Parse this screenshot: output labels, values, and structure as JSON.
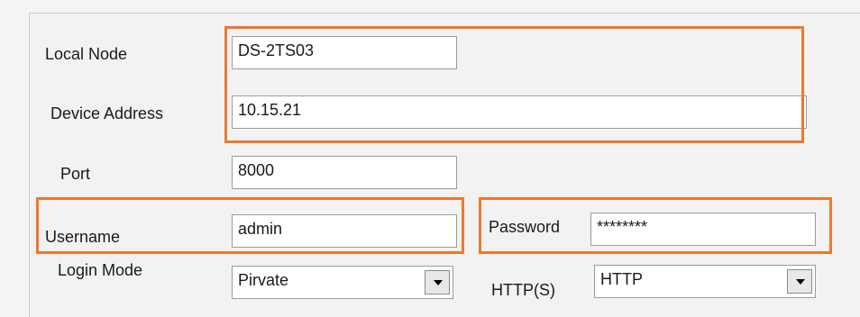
{
  "colors": {
    "highlight": "#ec7a2c",
    "field_border": "#9c9c9c",
    "background": "#f4f4f4"
  },
  "form": {
    "local_node": {
      "label": "Local Node",
      "value": "DS-2TS03"
    },
    "device_address": {
      "label": "Device Address",
      "value": "10.15.21"
    },
    "port": {
      "label": "Port",
      "value": "8000"
    },
    "username": {
      "label": "Username",
      "value": "admin"
    },
    "password": {
      "label": "Password",
      "value": "********"
    },
    "login_mode": {
      "label": "Login Mode",
      "value": "Pirvate",
      "icon": "dropdown-arrow-icon"
    },
    "https": {
      "label": "HTTP(S)",
      "value": "HTTP",
      "icon": "dropdown-arrow-icon"
    }
  }
}
